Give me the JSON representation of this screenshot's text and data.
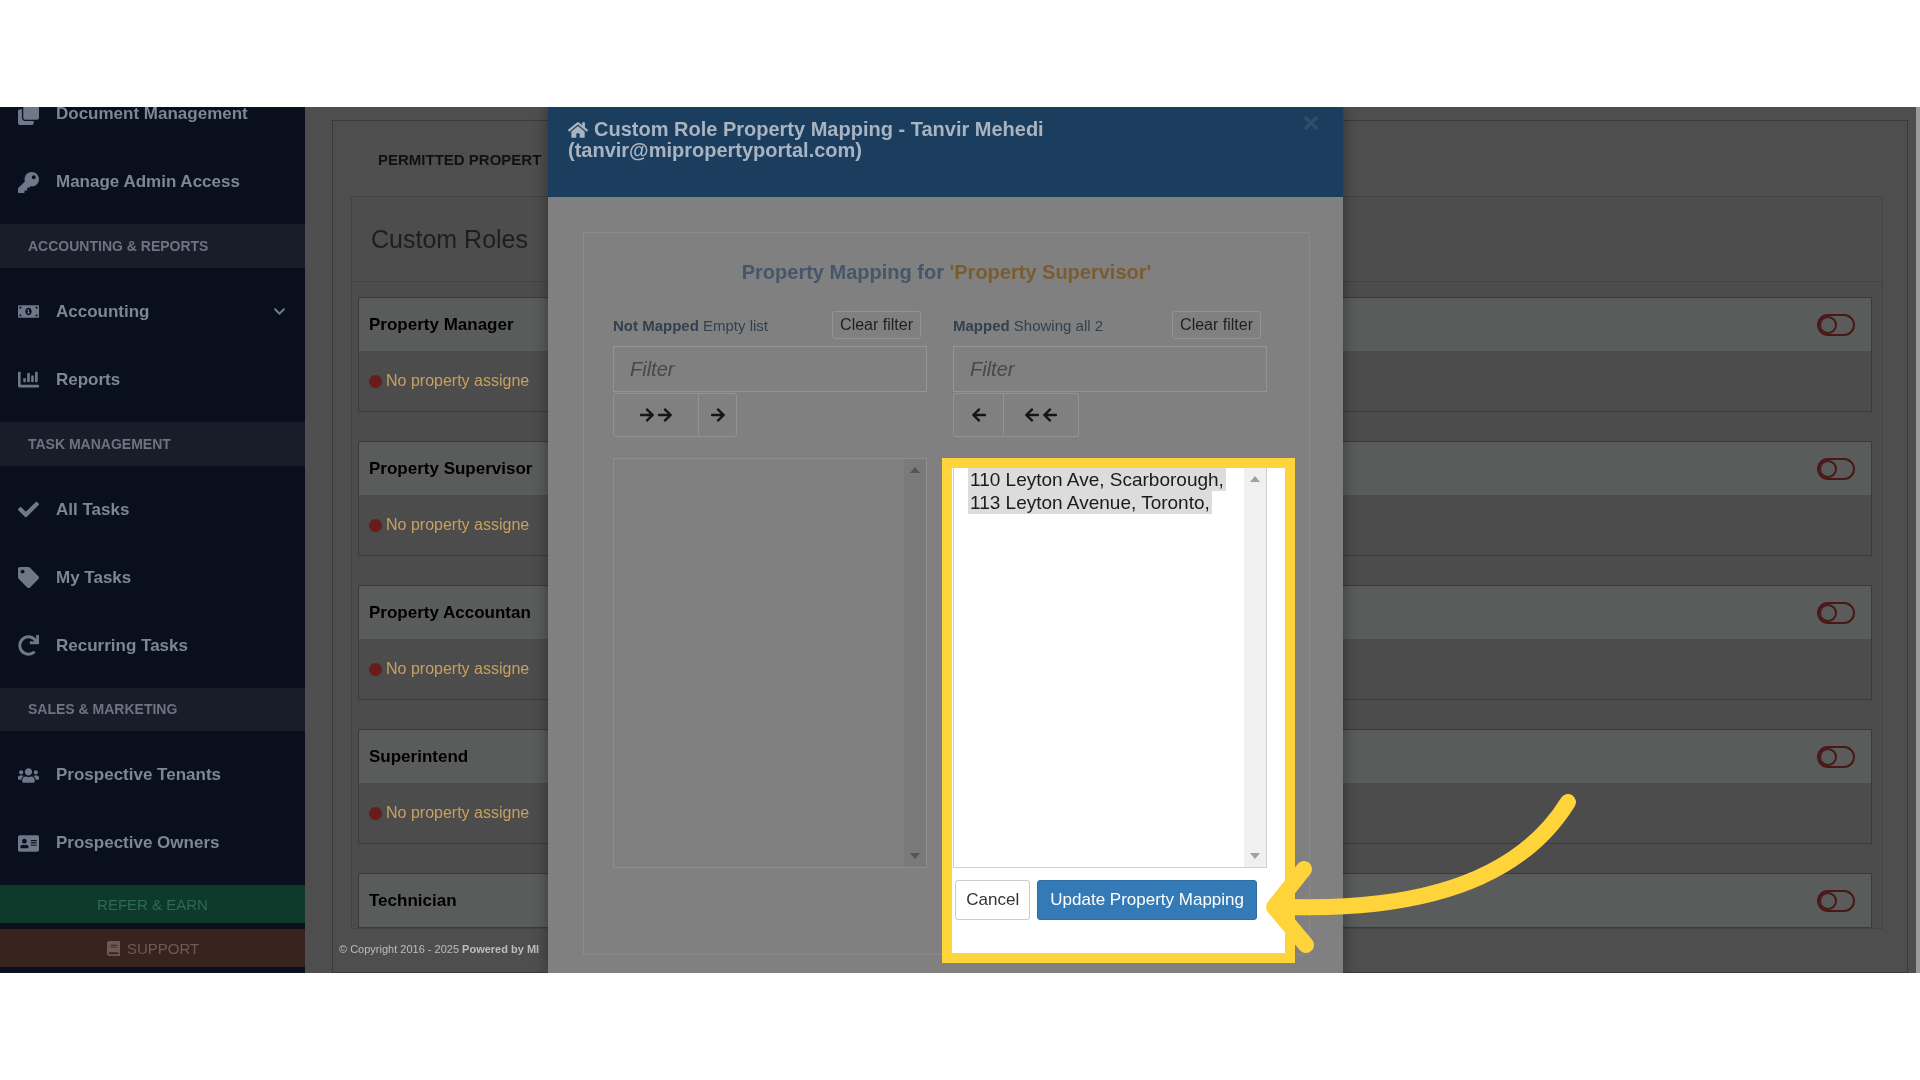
{
  "sidebar": {
    "items": [
      {
        "kind": "link",
        "label": "Document Management",
        "expandable": false
      },
      {
        "kind": "link",
        "label": "Manage Admin Access",
        "expandable": false
      },
      {
        "kind": "section",
        "label": "ACCOUNTING & REPORTS"
      },
      {
        "kind": "link",
        "label": "Accounting",
        "expandable": true
      },
      {
        "kind": "link",
        "label": "Reports",
        "expandable": false
      },
      {
        "kind": "section",
        "label": "TASK MANAGEMENT"
      },
      {
        "kind": "link",
        "label": "All Tasks",
        "expandable": false
      },
      {
        "kind": "link",
        "label": "My Tasks",
        "expandable": false
      },
      {
        "kind": "link",
        "label": "Recurring Tasks",
        "expandable": false
      },
      {
        "kind": "section",
        "label": "SALES & MARKETING"
      },
      {
        "kind": "link",
        "label": "Prospective Tenants",
        "expandable": false
      },
      {
        "kind": "link",
        "label": "Prospective Owners",
        "expandable": false
      }
    ],
    "refer_button": "REFER & EARN",
    "support_button": "SUPPORT"
  },
  "main": {
    "breadcrumb": "PERMITTED PROPERT",
    "card_title": "Custom Roles",
    "roles": [
      {
        "name": "Property Manager",
        "status": "No property assigne",
        "on": false
      },
      {
        "name": "Property Supervisor",
        "status": "No property assigne",
        "on": false
      },
      {
        "name": "Property Accountan",
        "status": "No property assigne",
        "on": false
      },
      {
        "name": "Superintend",
        "status": "No property assigne",
        "on": false
      },
      {
        "name": "Technician",
        "on": false
      }
    ],
    "footer": "© Copyright 2016 - 2025 **Powered by MI**"
  },
  "modal": {
    "title": "Custom Role Property Mapping - Tanvir Mehedi",
    "subtitle": "(tanvir@mipropertyportal.com)",
    "heading": {
      "text": "Property Mapping for",
      "role": "'Property Supervisor'"
    },
    "lists": [
      {
        "kind": "source",
        "label": "Not Mapped",
        "info": "Empty list",
        "clear_button": "Clear filter",
        "filter_placeholder": "Filter"
      },
      {
        "kind": "target",
        "label": "Mapped",
        "info": "Showing all 2",
        "clear_button": "Clear filter",
        "filter_placeholder": "Filter",
        "items": [
          {
            "text": "110 Leyton Ave, Scarborough,",
            "selected": true
          },
          {
            "text": "113 Leyton Avenue, Toronto,",
            "selected": true
          }
        ]
      }
    ],
    "cancel_button": "Cancel",
    "submit_button": "Update Property Mapping"
  }
}
